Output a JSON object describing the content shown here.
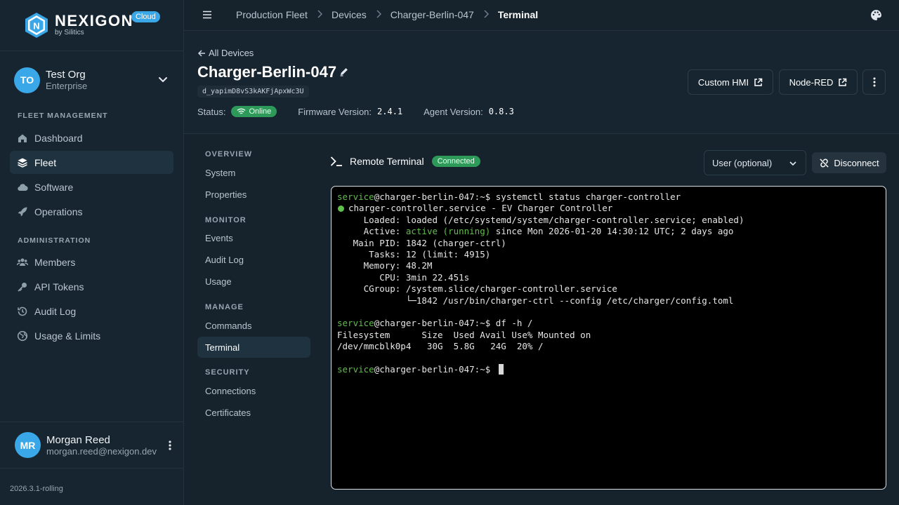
{
  "app": {
    "brand_name": "NEXIGON",
    "brand_sub": "by Silitics",
    "cloud_badge": "Cloud",
    "version": "2026.3.1-rolling"
  },
  "org": {
    "initials": "TO",
    "name": "Test Org",
    "plan": "Enterprise"
  },
  "sidebar": {
    "fleet_section": "FLEET MANAGEMENT",
    "fleet_items": [
      {
        "label": "Dashboard",
        "icon": "home-icon"
      },
      {
        "label": "Fleet",
        "icon": "layers-icon",
        "active": true
      },
      {
        "label": "Software",
        "icon": "cloud-icon"
      },
      {
        "label": "Operations",
        "icon": "rocket-icon"
      }
    ],
    "admin_section": "ADMINISTRATION",
    "admin_items": [
      {
        "label": "Members",
        "icon": "users-icon"
      },
      {
        "label": "API Tokens",
        "icon": "key-icon"
      },
      {
        "label": "Audit Log",
        "icon": "history-icon"
      },
      {
        "label": "Usage & Limits",
        "icon": "globe-icon"
      }
    ]
  },
  "user": {
    "initials": "MR",
    "name": "Morgan Reed",
    "email": "morgan.reed@nexigon.dev"
  },
  "breadcrumbs": [
    "Production Fleet",
    "Devices",
    "Charger-Berlin-047",
    "Terminal"
  ],
  "device": {
    "back_label": "All Devices",
    "name": "Charger-Berlin-047",
    "id": "d_yapimD8vS3kAKFjApxWc3U",
    "status_label": "Status:",
    "status": "Online",
    "firmware_label": "Firmware Version:",
    "firmware": "2.4.1",
    "agent_label": "Agent Version:",
    "agent": "0.8.3",
    "buttons": {
      "custom_hmi": "Custom HMI",
      "node_red": "Node-RED"
    }
  },
  "subnav": {
    "overview": "OVERVIEW",
    "system": "System",
    "properties": "Properties",
    "monitor": "MONITOR",
    "events": "Events",
    "audit_log": "Audit Log",
    "usage": "Usage",
    "manage": "MANAGE",
    "commands": "Commands",
    "terminal": "Terminal",
    "security": "SECURITY",
    "connections": "Connections",
    "certificates": "Certificates"
  },
  "terminal": {
    "title": "Remote Terminal",
    "status": "Connected",
    "user_placeholder": "User (optional)",
    "disconnect": "Disconnect",
    "prompt_user": "service",
    "prompt_host": "@charger-berlin-047:~$ ",
    "lines": {
      "l1_cmd": "systemctl status charger-controller",
      "l2": "charger-controller.service - EV Charger Controller",
      "l3": "     Loaded: loaded (/etc/systemd/system/charger-controller.service; enabled)",
      "l4_pre": "     Active: ",
      "l4_active": "active (running)",
      "l4_post": " since Mon 2026-01-20 14:30:12 UTC; 2 days ago",
      "l5": "   Main PID: 1842 (charger-ctrl)",
      "l6": "      Tasks: 12 (limit: 4915)",
      "l7": "     Memory: 48.2M",
      "l8": "        CPU: 3min 22.451s",
      "l9": "     CGroup: /system.slice/charger-controller.service",
      "l10": "             └─1842 /usr/bin/charger-ctrl --config /etc/charger/config.toml",
      "l12_cmd": "df -h /",
      "l13": "Filesystem      Size  Used Avail Use% Mounted on",
      "l14": "/dev/mmcblk0p4   30G  5.8G   24G  20% /"
    }
  },
  "colors": {
    "accent": "#3aa8e8",
    "online": "#2e9a5a",
    "terminal_green": "#5fbf4a"
  }
}
